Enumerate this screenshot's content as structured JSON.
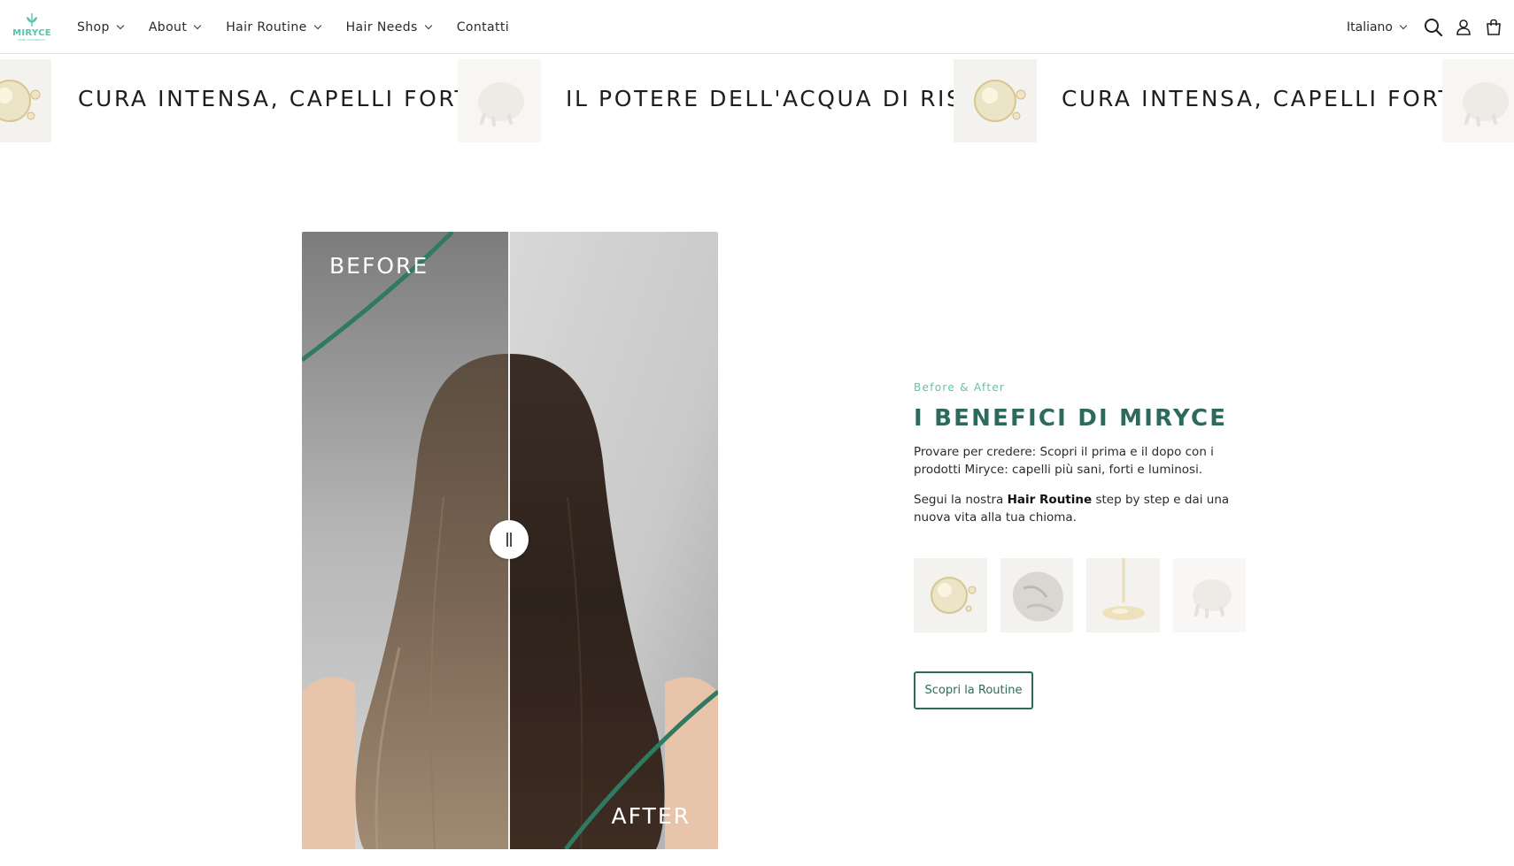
{
  "brand": {
    "logo_text": "MIRYCE",
    "logo_tagline": "MADE YOUR BEAUTY",
    "accent_color": "#5ec4ae",
    "dark_green": "#2d6a5c"
  },
  "nav": {
    "items": [
      {
        "label": "Shop",
        "has_dropdown": true
      },
      {
        "label": "About",
        "has_dropdown": true
      },
      {
        "label": "Hair Routine",
        "has_dropdown": true
      },
      {
        "label": "Hair Needs",
        "has_dropdown": true
      },
      {
        "label": "Contatti",
        "has_dropdown": false
      }
    ]
  },
  "header_tools": {
    "language": "Italiano",
    "icons": [
      "search-icon",
      "account-icon",
      "cart-icon"
    ]
  },
  "marquee": {
    "items": [
      "CURA INTENSA, CAPELLI FORTI",
      "IL POTERE DELL'ACQUA DI RISO",
      "CURA INTENSA, CAPELLI FORTI"
    ]
  },
  "comparison": {
    "before_label": "BEFORE",
    "after_label": "AFTER",
    "slider_position": 0.5
  },
  "benefits": {
    "eyebrow": "Before & After",
    "title": "I BENEFICI DI MIRYCE",
    "paragraph1": "Provare per credere: Scopri il prima e il dopo con i prodotti Miryce: capelli più sani, forti e luminosi.",
    "paragraph2_prefix": "Segui la nostra ",
    "paragraph2_bold": "Hair Routine",
    "paragraph2_suffix": " step by step e dai una nuova vita alla tua chioma.",
    "thumbnails": [
      "oil-drop-product",
      "cream-texture-product",
      "serum-drip-product",
      "white-cream-product"
    ],
    "cta_label": "Scopri la Routine"
  }
}
